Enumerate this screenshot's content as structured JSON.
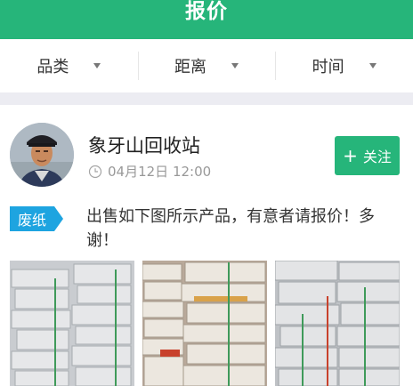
{
  "header": {
    "title": "报价"
  },
  "filters": [
    {
      "label": "品类"
    },
    {
      "label": "距离"
    },
    {
      "label": "时间"
    }
  ],
  "post": {
    "poster_name": "象牙山回收站",
    "time": "04月12日 12:00",
    "follow_label": "关注",
    "category_tag": "废纸",
    "description": "出售如下图所示产品，有意者请报价！多谢！",
    "photo_count": 3
  },
  "icons": {
    "follow": "plus-icon",
    "time": "clock-icon",
    "filter_caret": "caret-down-icon"
  },
  "colors": {
    "brand_green": "#26b57a",
    "tag_blue": "#1ea4e0",
    "divider_gray": "#ececf2"
  }
}
